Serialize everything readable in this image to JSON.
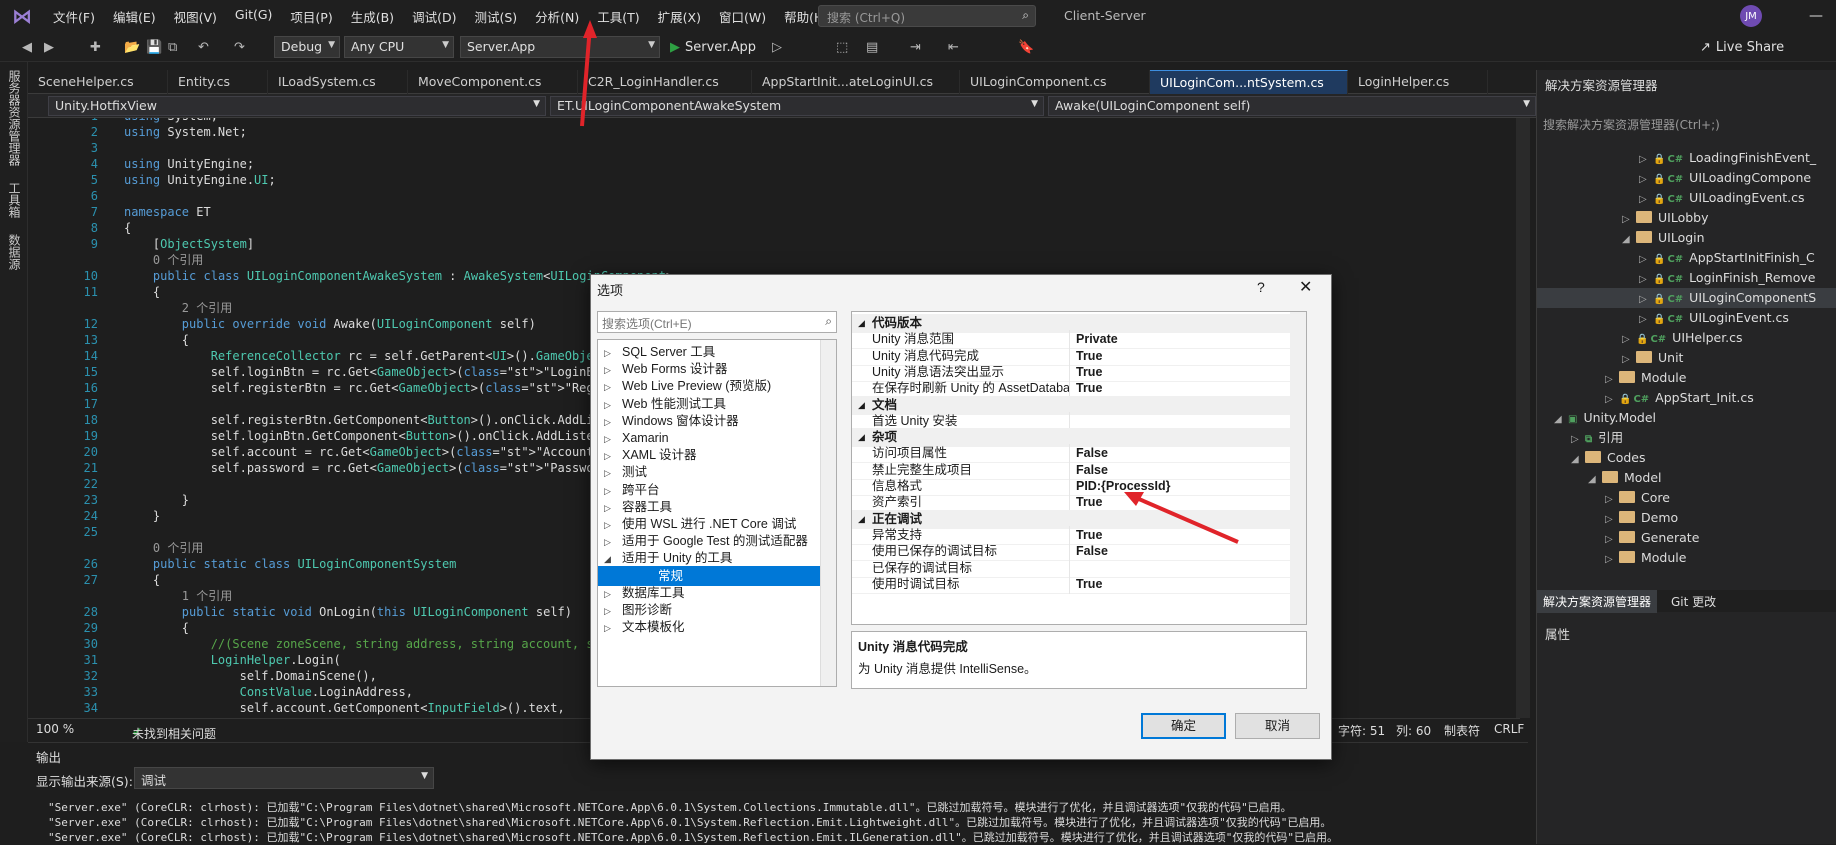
{
  "menubar": {
    "items": [
      "文件(F)",
      "编辑(E)",
      "视图(V)",
      "Git(G)",
      "项目(P)",
      "生成(B)",
      "调试(D)",
      "测试(S)",
      "分析(N)",
      "工具(T)",
      "扩展(X)",
      "窗口(W)",
      "帮助(H)"
    ],
    "search_placeholder": "搜索 (Ctrl+Q)",
    "solution_name": "Client-Server",
    "avatar_initials": "JM"
  },
  "toolbar": {
    "config": "Debug",
    "platform": "Any CPU",
    "project": "Server.App",
    "run_label": "Server.App",
    "live_share": "Live Share"
  },
  "left_strip": {
    "labels": [
      "服务器资源管理器",
      "工具箱",
      "数据源"
    ]
  },
  "tabs": [
    "SceneHelper.cs",
    "Entity.cs",
    "ILoadSystem.cs",
    "MoveComponent.cs",
    "C2R_LoginHandler.cs",
    "AppStartInit...ateLoginUI.cs",
    "UILoginComponent.cs",
    "UILoginCom...ntSystem.cs",
    "LoginHelper.cs"
  ],
  "active_tab": "UILoginCom...ntSystem.cs",
  "navbar": {
    "project": "Unity.HotfixView",
    "type": "ET.UILoginComponentAwakeSystem",
    "member": "Awake(UILoginComponent self)"
  },
  "code_lines": [
    {
      "n": "1",
      "t": "using System;"
    },
    {
      "n": "2",
      "t": "using System.Net;"
    },
    {
      "n": "3",
      "t": ""
    },
    {
      "n": "4",
      "t": "using UnityEngine;"
    },
    {
      "n": "5",
      "t": "using UnityEngine.UI;"
    },
    {
      "n": "6",
      "t": ""
    },
    {
      "n": "7",
      "t": "namespace ET"
    },
    {
      "n": "8",
      "t": "{"
    },
    {
      "n": "9",
      "t": "    [ObjectSystem]"
    },
    {
      "n": "",
      "t": "    0 个引用"
    },
    {
      "n": "10",
      "t": "    public class UILoginComponentAwakeSystem : AwakeSystem<UILoginComponent>"
    },
    {
      "n": "11",
      "t": "    {"
    },
    {
      "n": "",
      "t": "        2 个引用"
    },
    {
      "n": "12",
      "t": "        public override void Awake(UILoginComponent self)"
    },
    {
      "n": "13",
      "t": "        {"
    },
    {
      "n": "14",
      "t": "            ReferenceCollector rc = self.GetParent<UI>().GameObject"
    },
    {
      "n": "15",
      "t": "            self.loginBtn = rc.Get<GameObject>(\"LoginBtn\");"
    },
    {
      "n": "16",
      "t": "            self.registerBtn = rc.Get<GameObject>(\"RegisterBtn\");"
    },
    {
      "n": "17",
      "t": ""
    },
    {
      "n": "18",
      "t": "            self.registerBtn.GetComponent<Button>().onClick.AddList"
    },
    {
      "n": "19",
      "t": "            self.loginBtn.GetComponent<Button>().onClick.AddListe"
    },
    {
      "n": "20",
      "t": "            self.account = rc.Get<GameObject>(\"Account\");"
    },
    {
      "n": "21",
      "t": "            self.password = rc.Get<GameObject>(\"Password\");"
    },
    {
      "n": "22",
      "t": ""
    },
    {
      "n": "23",
      "t": "        }"
    },
    {
      "n": "24",
      "t": "    }"
    },
    {
      "n": "25",
      "t": ""
    },
    {
      "n": "",
      "t": "    0 个引用"
    },
    {
      "n": "26",
      "t": "    public static class UILoginComponentSystem"
    },
    {
      "n": "27",
      "t": "    {"
    },
    {
      "n": "",
      "t": "        1 个引用"
    },
    {
      "n": "28",
      "t": "        public static void OnLogin(this UILoginComponent self)"
    },
    {
      "n": "29",
      "t": "        {"
    },
    {
      "n": "30",
      "t": "            //(Scene zoneScene, string address, string account, st"
    },
    {
      "n": "31",
      "t": "            LoginHelper.Login("
    },
    {
      "n": "32",
      "t": "                self.DomainScene(),"
    },
    {
      "n": "33",
      "t": "                ConstValue.LoginAddress,"
    },
    {
      "n": "34",
      "t": "                self.account.GetComponent<InputField>().text,"
    }
  ],
  "editor_status": {
    "zoom": "100 %",
    "issues": "未找到相关问题",
    "char": "字符: 51",
    "col": "列: 60",
    "tabs": "制表符",
    "eol": "CRLF"
  },
  "output": {
    "title": "输出",
    "source_label": "显示输出来源(S):",
    "source_value": "调试",
    "lines": [
      "\"Server.exe\" (CoreCLR: clrhost): 已加载\"C:\\Program Files\\dotnet\\shared\\Microsoft.NETCore.App\\6.0.1\\System.Collections.Immutable.dll\"。已跳过加载符号。模块进行了优化，并且调试器选项\"仅我的代码\"已启用。",
      "\"Server.exe\" (CoreCLR: clrhost): 已加载\"C:\\Program Files\\dotnet\\shared\\Microsoft.NETCore.App\\6.0.1\\System.Reflection.Emit.Lightweight.dll\"。已跳过加载符号。模块进行了优化，并且调试器选项\"仅我的代码\"已启用。",
      "\"Server.exe\" (CoreCLR: clrhost): 已加载\"C:\\Program Files\\dotnet\\shared\\Microsoft.NETCore.App\\6.0.1\\System.Reflection.Emit.ILGeneration.dll\"。已跳过加载符号。模块进行了优化，并且调试器选项\"仅我的代码\"已启用。"
    ]
  },
  "solution_explorer": {
    "title": "解决方案资源管理器",
    "search_placeholder": "搜索解决方案资源管理器(Ctrl+;)",
    "items": [
      {
        "label": "LoadingFinishEvent_",
        "kind": "cs",
        "indent": 6
      },
      {
        "label": "UILoadingCompone",
        "kind": "cs",
        "indent": 6
      },
      {
        "label": "UILoadingEvent.cs",
        "kind": "cs",
        "indent": 6
      },
      {
        "label": "UILobby",
        "kind": "folder",
        "indent": 5
      },
      {
        "label": "UILogin",
        "kind": "folder",
        "indent": 5,
        "open": true
      },
      {
        "label": "AppStartInitFinish_C",
        "kind": "cs",
        "indent": 6
      },
      {
        "label": "LoginFinish_Remove",
        "kind": "cs",
        "indent": 6
      },
      {
        "label": "UILoginComponentS",
        "kind": "cs",
        "indent": 6,
        "selected": true
      },
      {
        "label": "UILoginEvent.cs",
        "kind": "cs",
        "indent": 6
      },
      {
        "label": "UIHelper.cs",
        "kind": "cs",
        "indent": 5
      },
      {
        "label": "Unit",
        "kind": "folder",
        "indent": 5
      },
      {
        "label": "Module",
        "kind": "folder",
        "indent": 4
      },
      {
        "label": "AppStart_Init.cs",
        "kind": "cs",
        "indent": 4
      },
      {
        "label": "Unity.Model",
        "kind": "project",
        "indent": 1,
        "open": true
      },
      {
        "label": "引用",
        "kind": "ref",
        "indent": 2
      },
      {
        "label": "Codes",
        "kind": "folder",
        "indent": 2,
        "open": true
      },
      {
        "label": "Model",
        "kind": "folder",
        "indent": 3,
        "open": true
      },
      {
        "label": "Core",
        "kind": "folder",
        "indent": 4
      },
      {
        "label": "Demo",
        "kind": "folder",
        "indent": 4
      },
      {
        "label": "Generate",
        "kind": "folder",
        "indent": 4
      },
      {
        "label": "Module",
        "kind": "folder",
        "indent": 4
      }
    ],
    "bottom_tabs": [
      "解决方案资源管理器",
      "Git 更改"
    ],
    "properties_title": "属性"
  },
  "dialog": {
    "title": "选项",
    "search_placeholder": "搜索选项(Ctrl+E)",
    "tree": [
      {
        "label": "SQL Server 工具",
        "state": "closed"
      },
      {
        "label": "Web Forms 设计器",
        "state": "closed"
      },
      {
        "label": "Web Live Preview (预览版)",
        "state": "closed"
      },
      {
        "label": "Web 性能测试工具",
        "state": "closed"
      },
      {
        "label": "Windows 窗体设计器",
        "state": "closed"
      },
      {
        "label": "Xamarin",
        "state": "closed"
      },
      {
        "label": "XAML 设计器",
        "state": "closed"
      },
      {
        "label": "测试",
        "state": "closed"
      },
      {
        "label": "跨平台",
        "state": "closed"
      },
      {
        "label": "容器工具",
        "state": "closed"
      },
      {
        "label": "使用 WSL 进行 .NET Core 调试",
        "state": "closed"
      },
      {
        "label": "适用于 Google Test 的测试适配器",
        "state": "closed"
      },
      {
        "label": "适用于 Unity 的工具",
        "state": "open"
      },
      {
        "label": "常规",
        "state": "child",
        "selected": true
      },
      {
        "label": "数据库工具",
        "state": "closed"
      },
      {
        "label": "图形诊断",
        "state": "closed"
      },
      {
        "label": "文本模板化",
        "state": "closed"
      }
    ],
    "grid": [
      {
        "cat": "代码版本"
      },
      {
        "k": "Unity 消息范围",
        "v": "Private"
      },
      {
        "k": "Unity 消息代码完成",
        "v": "True"
      },
      {
        "k": "Unity 消息语法突出显示",
        "v": "True"
      },
      {
        "k": "在保存时刷新 Unity 的 AssetDataba",
        "v": "True"
      },
      {
        "cat": "文档"
      },
      {
        "k": "首选 Unity 安装",
        "v": ""
      },
      {
        "cat": "杂项"
      },
      {
        "k": "访问项目属性",
        "v": "False"
      },
      {
        "k": "禁止完整生成项目",
        "v": "False"
      },
      {
        "k": "信息格式",
        "v": "PID:{ProcessId}"
      },
      {
        "k": "资产索引",
        "v": "True"
      },
      {
        "cat": "正在调试"
      },
      {
        "k": "异常支持",
        "v": "True"
      },
      {
        "k": "使用已保存的调试目标",
        "v": "False"
      },
      {
        "k": "已保存的调试目标",
        "v": ""
      },
      {
        "k": "使用时调试目标",
        "v": "True"
      }
    ],
    "desc_title": "Unity 消息代码完成",
    "desc_text": "为 Unity 消息提供 IntelliSense。",
    "ok": "确定",
    "cancel": "取消"
  },
  "colors": {
    "accent": "#0078d7",
    "annotation": "#e0242a",
    "selection": "#1f3a5f"
  }
}
